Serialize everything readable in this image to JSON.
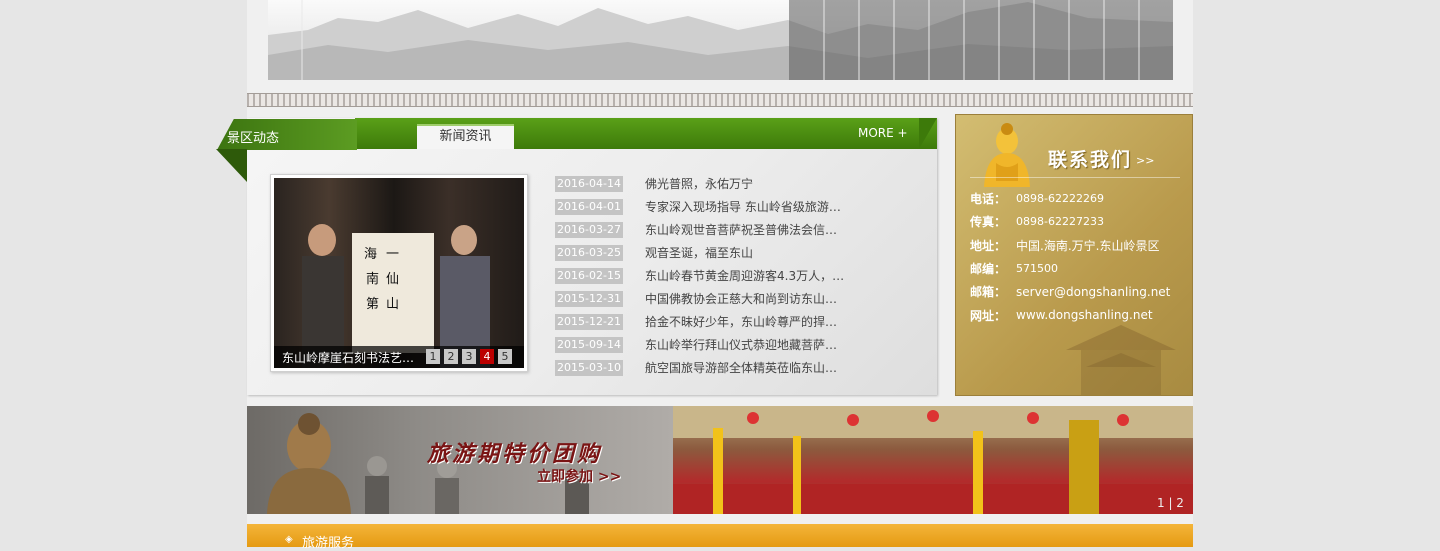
{
  "news_section": {
    "active_tab": "景区动态",
    "tab_news": "新闻资讯",
    "more": "MORE +",
    "featured": {
      "caption": "东山岭摩崖石刻书法艺术…",
      "pages": [
        "1",
        "2",
        "3",
        "4",
        "5"
      ],
      "active_page": "4"
    },
    "items": [
      {
        "date": "2016-04-14",
        "title": "佛光普照，永佑万宁"
      },
      {
        "date": "2016-04-01",
        "title": "专家深入现场指导 东山岭省级旅游…"
      },
      {
        "date": "2016-03-27",
        "title": "东山岭观世音菩萨祝圣普佛法会信…"
      },
      {
        "date": "2016-03-25",
        "title": "观音圣诞，福至东山"
      },
      {
        "date": "2016-02-15",
        "title": "东山岭春节黄金周迎游客4.3万人，…"
      },
      {
        "date": "2015-12-31",
        "title": "中国佛教协会正慈大和尚到访东山…"
      },
      {
        "date": "2015-12-21",
        "title": "拾金不昧好少年，东山岭尊严的捍…"
      },
      {
        "date": "2015-09-14",
        "title": "东山岭举行拜山仪式恭迎地藏菩萨…"
      },
      {
        "date": "2015-03-10",
        "title": "航空国旅导游部全体精英莅临东山…"
      }
    ]
  },
  "contact": {
    "title": "联系我们",
    "arrow": ">>",
    "rows": [
      {
        "label": "电话：",
        "value": "0898-62222269"
      },
      {
        "label": "传真：",
        "value": "0898-62227233"
      },
      {
        "label": "地址：",
        "value": "中国.海南.万宁.东山岭景区"
      },
      {
        "label": "邮编：",
        "value": "571500"
      },
      {
        "label": "邮箱：",
        "value": "server@dongshanling.net"
      },
      {
        "label": "网址：",
        "value": "www.dongshanling.net"
      }
    ]
  },
  "promo": {
    "headline": "旅游期特价团购",
    "cta": "立即参加 >>",
    "pager": "1 | 2"
  },
  "service": {
    "label": "旅游服务"
  },
  "colors": {
    "green": "#4a8a12",
    "gold": "#c4a55a",
    "orange": "#eda321",
    "date_bg": "#c4c4c4",
    "active_page": "#bb0000"
  }
}
